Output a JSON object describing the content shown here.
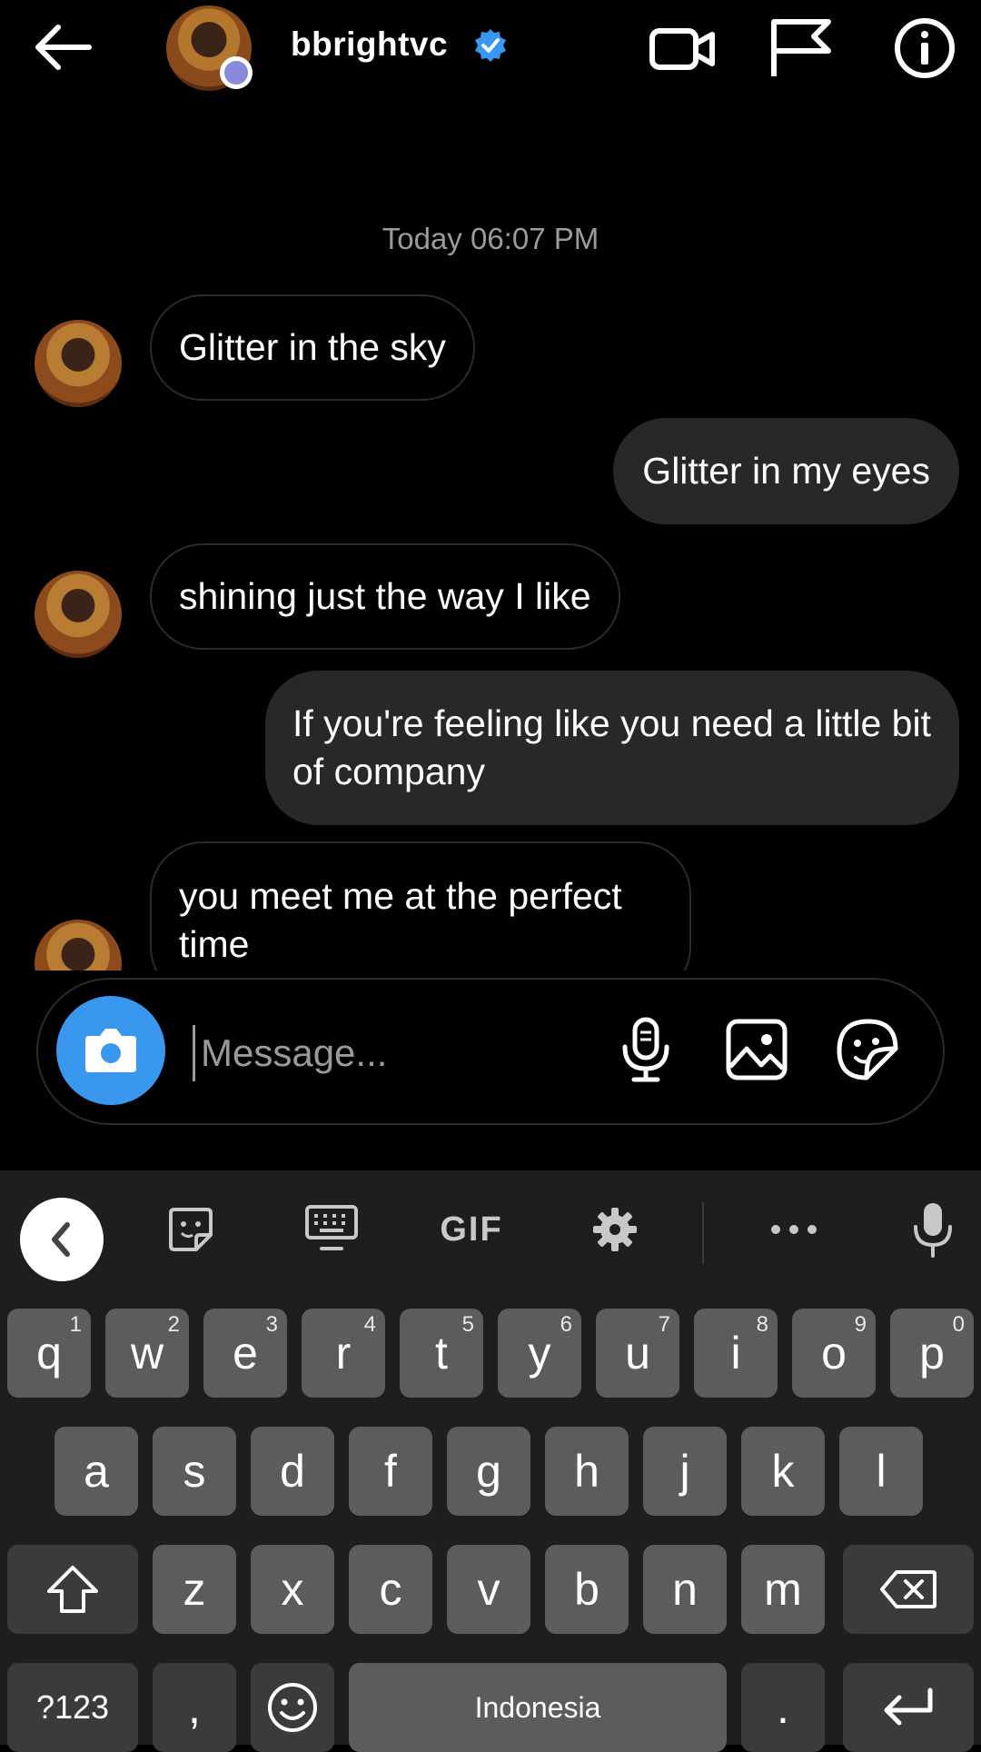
{
  "header": {
    "username": "bbrightvc",
    "icons": [
      "back-arrow-icon",
      "verified-badge-icon",
      "video-call-icon",
      "flag-icon",
      "info-icon"
    ],
    "accent": "#3897f0"
  },
  "chat": {
    "timestamp": "Today 06:07 PM",
    "messages": [
      {
        "direction": "incoming",
        "text": "Glitter in the sky"
      },
      {
        "direction": "outgoing",
        "text": "Glitter in my eyes"
      },
      {
        "direction": "incoming",
        "text": "shining just the way I like"
      },
      {
        "direction": "outgoing",
        "text": "If you're feeling like you need a little bit of company"
      },
      {
        "direction": "incoming",
        "text": "you meet me at the perfect time"
      }
    ]
  },
  "composer": {
    "placeholder": "Message...",
    "icons": [
      "camera-icon",
      "microphone-icon",
      "gallery-icon",
      "sticker-icon"
    ]
  },
  "keyboard": {
    "toolbar": {
      "gif_label": "GIF",
      "icons": [
        "collapse-icon",
        "sticker-icon",
        "keyboard-icon",
        "settings-icon",
        "more-icon",
        "voice-input-icon"
      ]
    },
    "row1": [
      {
        "label": "q",
        "hint": "1"
      },
      {
        "label": "w",
        "hint": "2"
      },
      {
        "label": "e",
        "hint": "3"
      },
      {
        "label": "r",
        "hint": "4"
      },
      {
        "label": "t",
        "hint": "5"
      },
      {
        "label": "y",
        "hint": "6"
      },
      {
        "label": "u",
        "hint": "7"
      },
      {
        "label": "i",
        "hint": "8"
      },
      {
        "label": "o",
        "hint": "9"
      },
      {
        "label": "p",
        "hint": "0"
      }
    ],
    "row2": [
      "a",
      "s",
      "d",
      "f",
      "g",
      "h",
      "j",
      "k",
      "l"
    ],
    "row3": [
      "z",
      "x",
      "c",
      "v",
      "b",
      "n",
      "m"
    ],
    "symbols_label": "?123",
    "comma_label": ",",
    "space_label": "Indonesia",
    "period_label": ".",
    "icons": [
      "shift-icon",
      "backspace-icon",
      "emoji-icon",
      "enter-icon"
    ]
  }
}
